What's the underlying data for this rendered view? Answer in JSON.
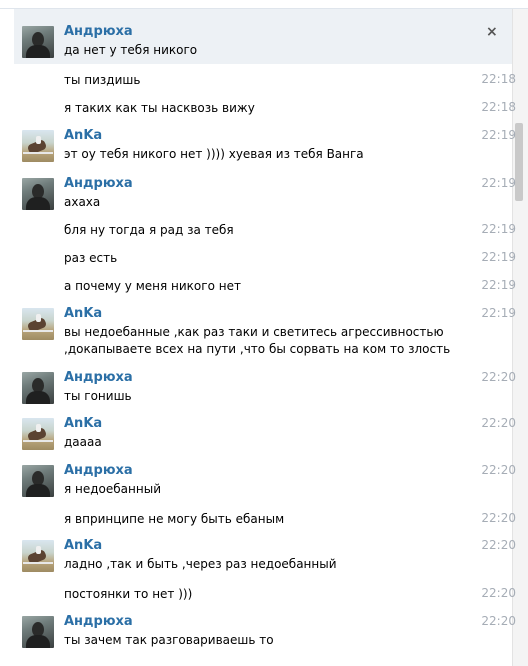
{
  "messages": [
    {
      "author": "Андрюха",
      "avatar": "andryukha",
      "text": "да нет у тебя никого",
      "time": "",
      "header": true
    },
    {
      "text": "ты пиздишь",
      "time": "22:18"
    },
    {
      "text": "я таких как ты насквозь вижу",
      "time": "22:18"
    },
    {
      "author": "AnKa",
      "avatar": "anka",
      "text": "эт оу тебя никого нет )))) хуевая из тебя Ванга",
      "time": "22:19",
      "header": true
    },
    {
      "author": "Андрюха",
      "avatar": "andryukha",
      "text": "ахаха",
      "time": "22:19",
      "header": true
    },
    {
      "text": "бля ну тогда я рад за тебя",
      "time": "22:19"
    },
    {
      "text": "раз есть",
      "time": "22:19"
    },
    {
      "text": "а почему у меня никого нет",
      "time": "22:19"
    },
    {
      "author": "AnKa",
      "avatar": "anka",
      "text": "вы недоебанные ,как раз таки и светитесь агрессивностью",
      "text2": ",докапываете всех на пути ,что бы сорвать на ком то злость",
      "time": "22:19",
      "header": true
    },
    {
      "author": "Андрюха",
      "avatar": "andryukha",
      "text": "ты гонишь",
      "time": "22:20",
      "header": true
    },
    {
      "author": "AnKa",
      "avatar": "anka",
      "text": "даааа",
      "time": "22:20",
      "header": true
    },
    {
      "author": "Андрюха",
      "avatar": "andryukha",
      "text": "я недоебанный",
      "time": "22:20",
      "header": true
    },
    {
      "text": "я впринципе не могу быть ебаным",
      "time": "22:20"
    },
    {
      "author": "AnKa",
      "avatar": "anka",
      "text": "ладно ,так и быть ,через раз недоебанный",
      "time": "22:20",
      "header": true
    },
    {
      "text": "постоянки то нет )))",
      "time": "22:20"
    },
    {
      "author": "Андрюха",
      "avatar": "andryukha",
      "text": "ты зачем так разговариваешь то",
      "time": "22:20",
      "header": true
    }
  ],
  "close_label": "×"
}
